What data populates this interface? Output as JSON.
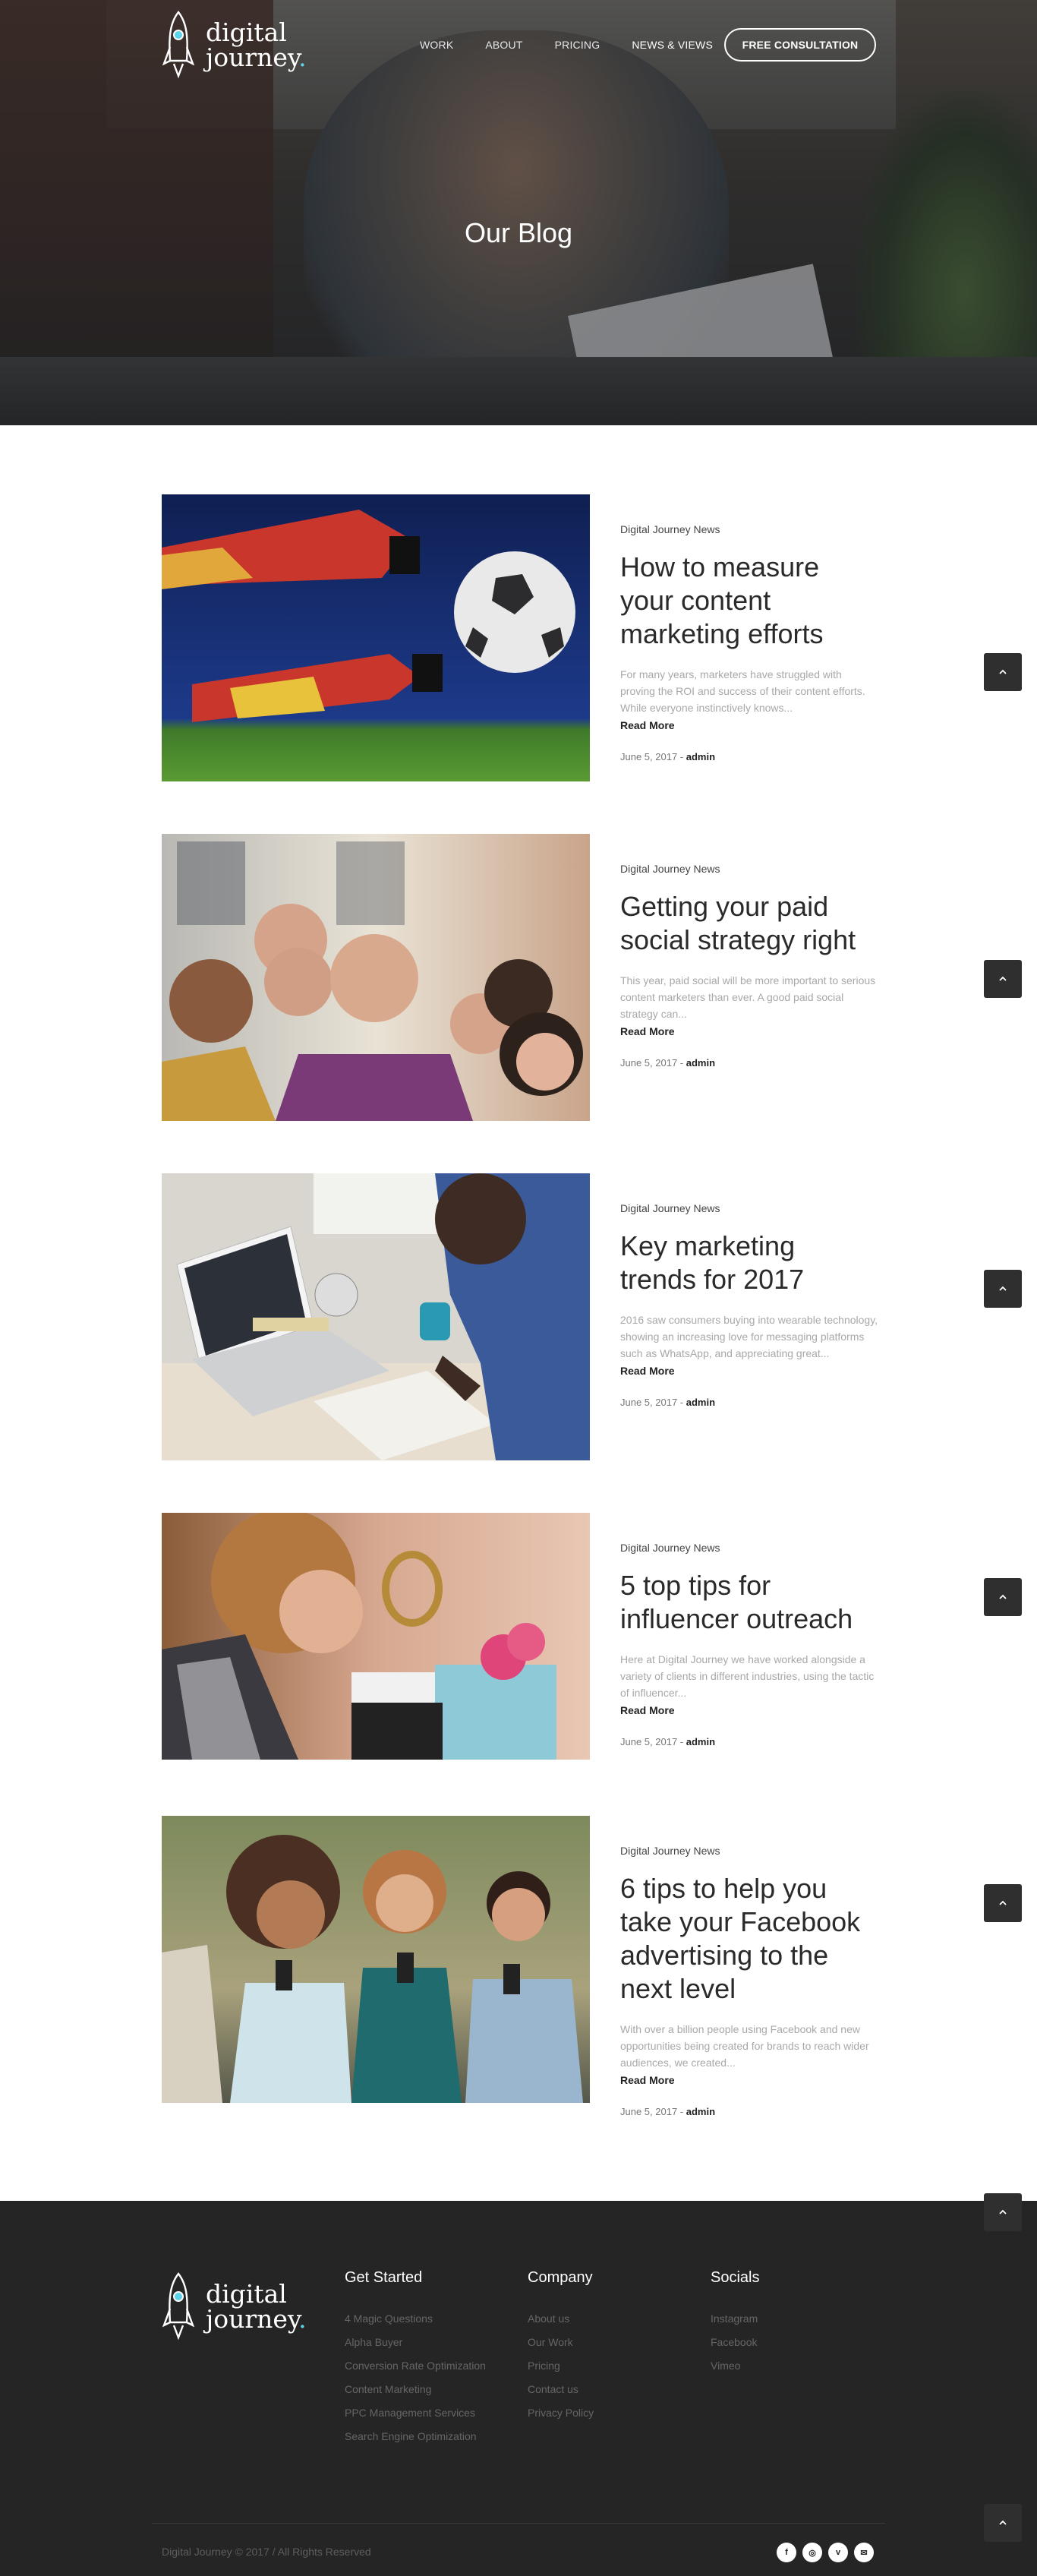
{
  "header": {
    "logo_line1": "digital",
    "logo_line2": "journey",
    "logo_dot": ".",
    "nav": [
      "WORK",
      "ABOUT",
      "PRICING",
      "NEWS & VIEWS"
    ],
    "cta": "FREE CONSULTATION",
    "hero_title": "Our Blog"
  },
  "posts": [
    {
      "category": "Digital Journey News",
      "title": "How to measure your content marketing efforts",
      "excerpt": "For many years, marketers have struggled with proving the ROI and success of their content efforts. While everyone instinctively knows...",
      "read_more": "Read More",
      "date": "June 5, 2017 - ",
      "author": "admin",
      "image": "goalkeeper-catching-ball"
    },
    {
      "category": "Digital Journey News",
      "title": "Getting your paid social strategy right",
      "excerpt": "This year, paid social will be more important to serious content marketers than ever. A good paid social strategy can...",
      "read_more": "Read More",
      "date": "June 5, 2017 - ",
      "author": "admin",
      "image": "group-selfie"
    },
    {
      "category": "Digital Journey News",
      "title": "Key marketing trends for 2017",
      "excerpt": "2016 saw consumers buying into wearable technology, showing an increasing love for messaging platforms such as WhatsApp, and appreciating great...",
      "read_more": "Read More",
      "date": "June 5, 2017 - ",
      "author": "admin",
      "image": "man-writing-laptop"
    },
    {
      "category": "Digital Journey News",
      "title": "5 top tips for influencer outreach",
      "excerpt": "Here at Digital Journey we have worked alongside a variety of clients in different industries, using the tactic of influencer...",
      "read_more": "Read More",
      "date": "June 5, 2017 - ",
      "author": "admin",
      "image": "woman-with-laptop"
    },
    {
      "category": "Digital Journey News",
      "title": "6 tips to help you take your Facebook advertising to the next level",
      "excerpt": "With over a billion people using Facebook and new opportunities being created for brands to reach wider audiences, we created...",
      "read_more": "Read More",
      "date": "June 5, 2017 - ",
      "author": "admin",
      "image": "friends-on-phones"
    }
  ],
  "footer": {
    "logo_line1": "digital",
    "logo_line2": "journey",
    "logo_dot": ".",
    "col1": {
      "title": "Get Started",
      "links": [
        "4 Magic Questions",
        "Alpha Buyer",
        "Conversion Rate Optimization",
        "Content Marketing",
        "PPC Management Services",
        "Search Engine Optimization"
      ]
    },
    "col2": {
      "title": "Company",
      "links": [
        "About us",
        "Our Work",
        "Pricing",
        "Contact us",
        "Privacy Policy"
      ]
    },
    "col3": {
      "title": "Socials",
      "links": [
        "Instagram",
        "Facebook",
        "Vimeo"
      ]
    },
    "copyright": "Digital Journey © 2017 / All Rights Reserved",
    "social_icons": [
      "facebook-icon",
      "instagram-icon",
      "vimeo-icon",
      "email-icon"
    ]
  },
  "colors": {
    "accent": "#5fd3ea",
    "footer_bg": "#252526",
    "scroll_button": "#2f2f30"
  }
}
